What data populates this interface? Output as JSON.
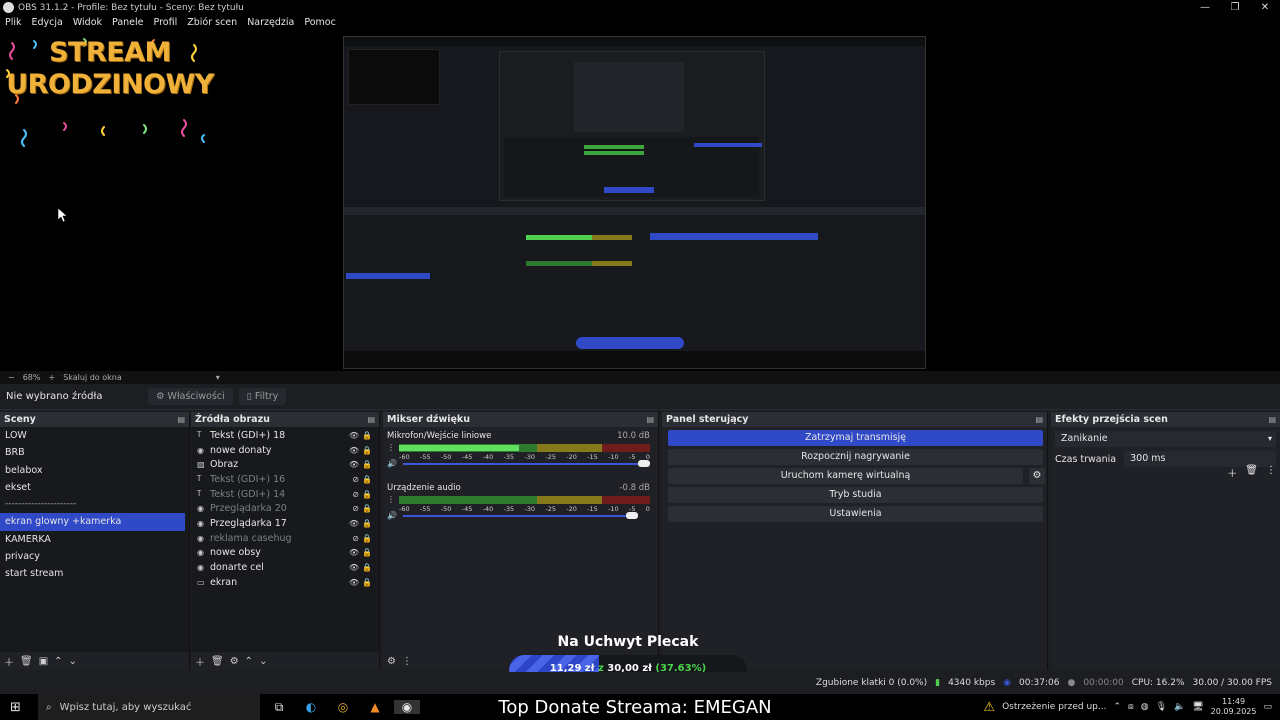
{
  "window": {
    "title": "OBS 31.1.2 - Profile: Bez tytułu - Sceny: Bez tytułu",
    "controls": [
      "—",
      "❐",
      "✕"
    ]
  },
  "menu": [
    "Plik",
    "Edycja",
    "Widok",
    "Panele",
    "Profil",
    "Zbiór scen",
    "Narzędzia",
    "Pomoc"
  ],
  "banner": {
    "line1": "STREAM",
    "line2": "URODZINOWY"
  },
  "zoom": {
    "minus": "−",
    "value": "68%",
    "plus": "+",
    "mode": "Skaluj do okna"
  },
  "source_bar": {
    "status": "Nie wybrano źródła",
    "properties": "Właściwości",
    "filters": "Filtry"
  },
  "scenes": {
    "title": "Sceny",
    "items": [
      "LOW",
      "BRB",
      "belabox",
      "ekset",
      "----------------------",
      "ekran glowny +kamerka",
      "KAMERKA",
      "privacy",
      "start stream"
    ],
    "selected_index": 5
  },
  "sources": {
    "title": "Źródła obrazu",
    "items": [
      {
        "name": "Tekst (GDI+) 18",
        "icon": "text-icon",
        "visible": true
      },
      {
        "name": "nowe donaty",
        "icon": "browser-icon",
        "visible": true
      },
      {
        "name": "Obraz",
        "icon": "image-icon",
        "visible": true
      },
      {
        "name": "Tekst (GDI+) 16",
        "icon": "text-icon",
        "visible": false
      },
      {
        "name": "Tekst (GDI+) 14",
        "icon": "text-icon",
        "visible": false
      },
      {
        "name": "Przeglądarka 20",
        "icon": "browser-icon",
        "visible": false
      },
      {
        "name": "Przeglądarka 17",
        "icon": "browser-icon",
        "visible": true
      },
      {
        "name": "reklama casehug",
        "icon": "browser-icon",
        "visible": false
      },
      {
        "name": "nowe obsy",
        "icon": "browser-icon",
        "visible": true
      },
      {
        "name": "donarte cel",
        "icon": "browser-icon",
        "visible": true
      },
      {
        "name": "ekran",
        "icon": "monitor-icon",
        "visible": true
      }
    ]
  },
  "mixer": {
    "title": "Mikser dźwięku",
    "channels": [
      {
        "name": "Mikrofon/Wejście liniowe",
        "db": "10.0 dB",
        "level": 0.48,
        "fader": 1.0
      },
      {
        "name": "Urządzenie audio",
        "db": "-0.8 dB",
        "level": 0.0,
        "fader": 0.97
      }
    ],
    "scale": [
      "-60",
      "-55",
      "-50",
      "-45",
      "-40",
      "-35",
      "-30",
      "-25",
      "-20",
      "-15",
      "-10",
      "-5",
      "0"
    ]
  },
  "controls": {
    "title": "Panel sterujący",
    "buttons": [
      "Zatrzymaj transmisję",
      "Rozpocznij nagrywanie",
      "Uruchom kamerę wirtualną",
      "Tryb studia",
      "Ustawienia"
    ]
  },
  "transitions": {
    "title": "Efekty przejścia scen",
    "selected": "Zanikanie",
    "duration_label": "Czas trwania",
    "duration_value": "300 ms"
  },
  "overlay": {
    "title": "Na Uchwyt Plecak",
    "current": "11,29 zł",
    "separator": "z",
    "goal": "30,00 zł",
    "percent_text": "(37.63%)",
    "progress": 0.3763
  },
  "status": {
    "dropped": "Zgubione klatki 0 (0.0%)",
    "bitrate": "4340 kbps",
    "stream_time": "00:37:06",
    "rec_time": "00:00:00",
    "cpu": "CPU: 16.2%",
    "fps": "30.00 / 30.00 FPS"
  },
  "taskbar": {
    "search_placeholder": "Wpisz tutaj, aby wyszukać",
    "donate_text": "Top Donate Streama: EMEGAN",
    "warning": "Ostrzeżenie przed up...",
    "time": "11:49",
    "date": "20.09.2025"
  },
  "colors": {
    "accent": "#3049c6",
    "banner": "#f0b13a",
    "meter_green": "#5fe05f",
    "percent_green": "#49d549"
  }
}
